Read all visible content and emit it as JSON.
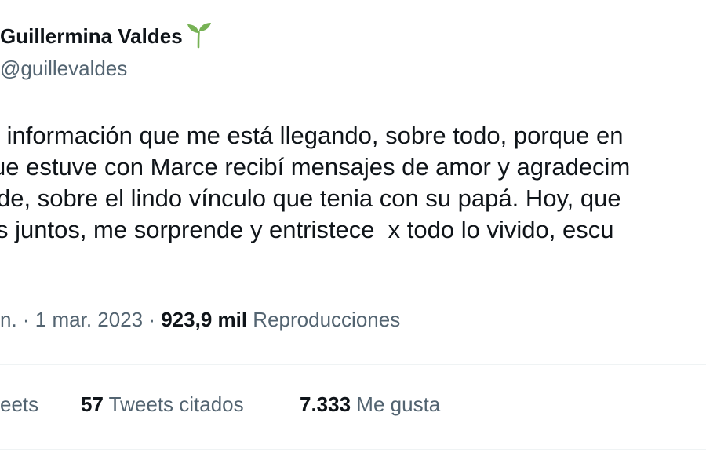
{
  "author": {
    "display_name": "Guillermina Valdes",
    "handle": "@guillevaldes",
    "badge_icon": "seedling-icon"
  },
  "tweet": {
    "lines": [
      " información que me está llegando, sobre todo, porque en",
      "ue estuve con Marce recibí mensajes de amor y agradecim",
      "de, sobre el lindo vínculo que tenia con su papá. Hoy, que",
      "s juntos, me sorprende y entristece  x todo lo vivido, escu"
    ]
  },
  "meta": {
    "time_partial": "n. · ",
    "date": "1 mar. 2023",
    "separator": " · ",
    "views_count": "923,9 mil",
    "views_label": " Reproducciones"
  },
  "stats": {
    "retweets_label_partial": "eets",
    "quotes_count": "57",
    "quotes_label": " Tweets citados",
    "likes_count": "7.333",
    "likes_label": " Me gusta"
  },
  "colors": {
    "text_primary": "#0f1419",
    "text_secondary": "#536471",
    "divider": "#eff3f4",
    "seedling_green": "#77b255"
  }
}
